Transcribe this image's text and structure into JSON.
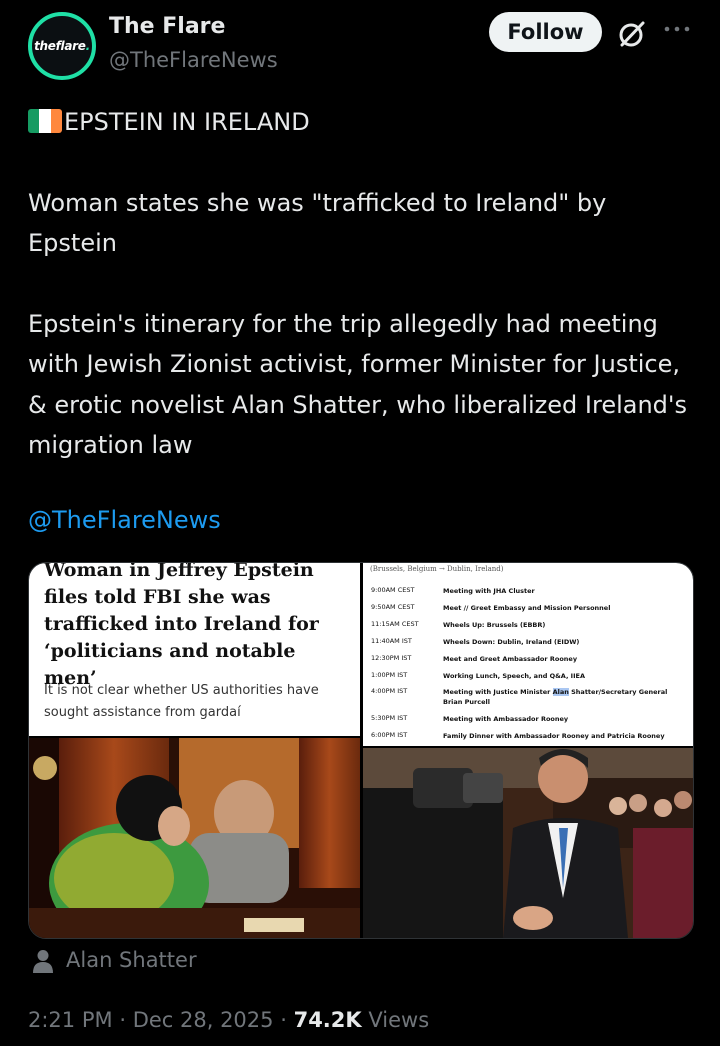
{
  "header": {
    "avatar_text": "theflare",
    "display_name": "The Flare",
    "handle": "@TheFlareNews",
    "follow_label": "Follow"
  },
  "tweet": {
    "title": "EPSTEIN IN IRELAND",
    "para1": "Woman states she was \"trafficked to Ireland\" by Epstein",
    "para2": "Epstein's itinerary for the trip allegedly had meeting with Jewish Zionist activist, former Minister for Justice, & erotic novelist Alan Shatter, who liberalized Ireland's migration law",
    "mention": "@TheFlareNews"
  },
  "flag_colors": [
    "#169b62",
    "#ffffff",
    "#ff883e"
  ],
  "media": {
    "headline": "Woman in Jeffrey Epstein files told FBI she was trafficked into Ireland for ‘politicians and notable men’",
    "subhead": "It is not clear whether US authorities have sought assistance from gardaí",
    "itinerary_header": "(Brussels, Belgium → Dublin, Ireland)",
    "itinerary": [
      {
        "time": "9:00AM CEST",
        "event": "Meeting with JHA Cluster"
      },
      {
        "time": "9:50AM CEST",
        "event": "Meet // Greet Embassy and Mission Personnel"
      },
      {
        "time": "11:15AM CEST",
        "event": "Wheels Up: Brussels (EBBR)"
      },
      {
        "time": "11:40AM IST",
        "event": "Wheels Down: Dublin, Ireland (EIDW)"
      },
      {
        "time": "12:30PM IST",
        "event": "Meet and Greet Ambassador Rooney"
      },
      {
        "time": "1:00PM IST",
        "event": "Working Lunch, Speech, and Q&A, IIEA"
      },
      {
        "time": "4:00PM IST",
        "event_pre": "Meeting with Justice Minister ",
        "event_hl": "Alan",
        "event_post": " Shatter/Secretary General Brian Purcell"
      },
      {
        "time": "5:30PM IST",
        "event": "Meeting with Ambassador Rooney"
      },
      {
        "time": "6:00PM IST",
        "event": "Family Dinner with Ambassador Rooney and Patricia Rooney"
      }
    ]
  },
  "tagged": {
    "label": "Alan Shatter"
  },
  "meta": {
    "time": "2:21 PM",
    "date": "Dec 28, 2025",
    "views_count": "74.2K",
    "views_label": "Views",
    "sep": "·"
  },
  "colors": {
    "accent": "#1d9bf0",
    "ring": "#1fe0a6",
    "muted": "#71767b"
  }
}
